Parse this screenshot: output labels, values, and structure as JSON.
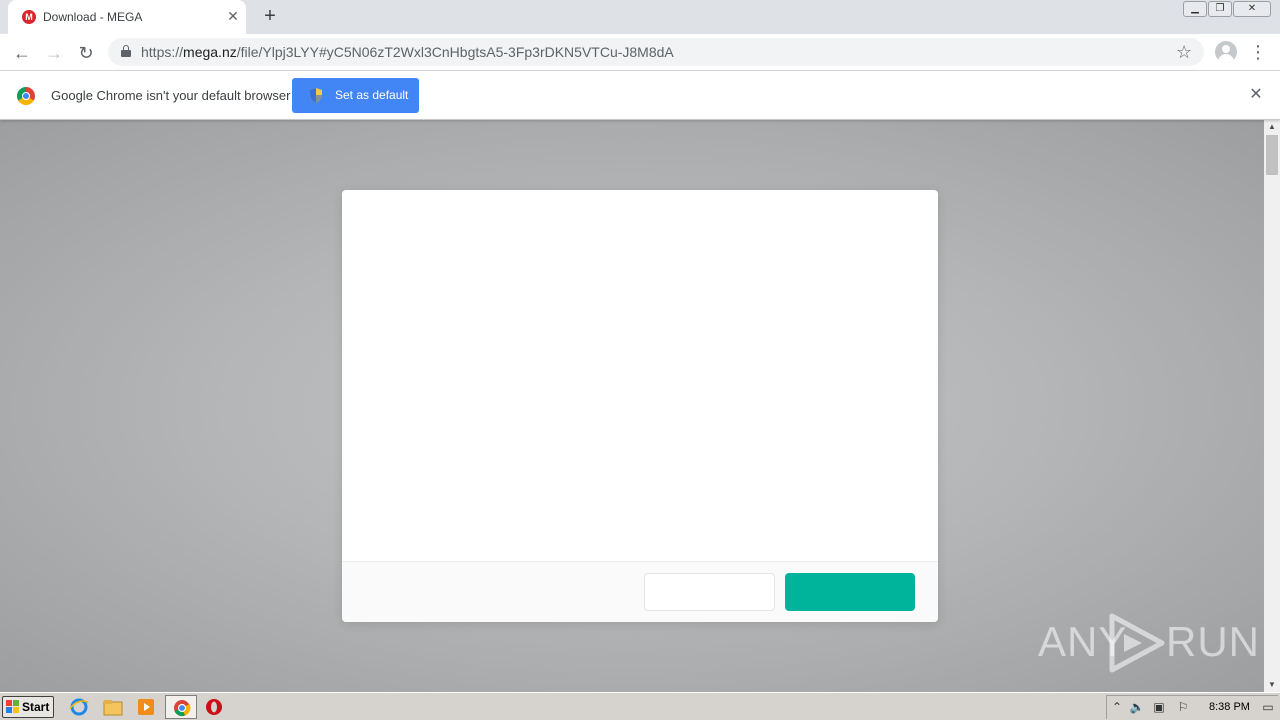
{
  "browser": {
    "tab": {
      "title": "Download - MEGA",
      "favicon": "M"
    },
    "new_tab_symbol": "+",
    "address": {
      "scheme": "https://",
      "host": "mega.nz",
      "path": "/file/Ylpj3LYY#yC5N06zT2Wxl3CnHbgtsA5-3Fp3rDKN5VTCu-J8M8dA"
    }
  },
  "infobar": {
    "message": "Google Chrome isn't your default browser",
    "button_label": "Set as default"
  },
  "dialog": {
    "secondary_button_label": "",
    "primary_button_label": ""
  },
  "colors": {
    "primary_button": "#00b39b",
    "infobar_button": "#4285f4",
    "mega_red": "#d9272e"
  },
  "watermark": {
    "left": "ANY",
    "right": "RUN"
  },
  "taskbar": {
    "start_label": "Start",
    "clock": "8:38 PM"
  }
}
